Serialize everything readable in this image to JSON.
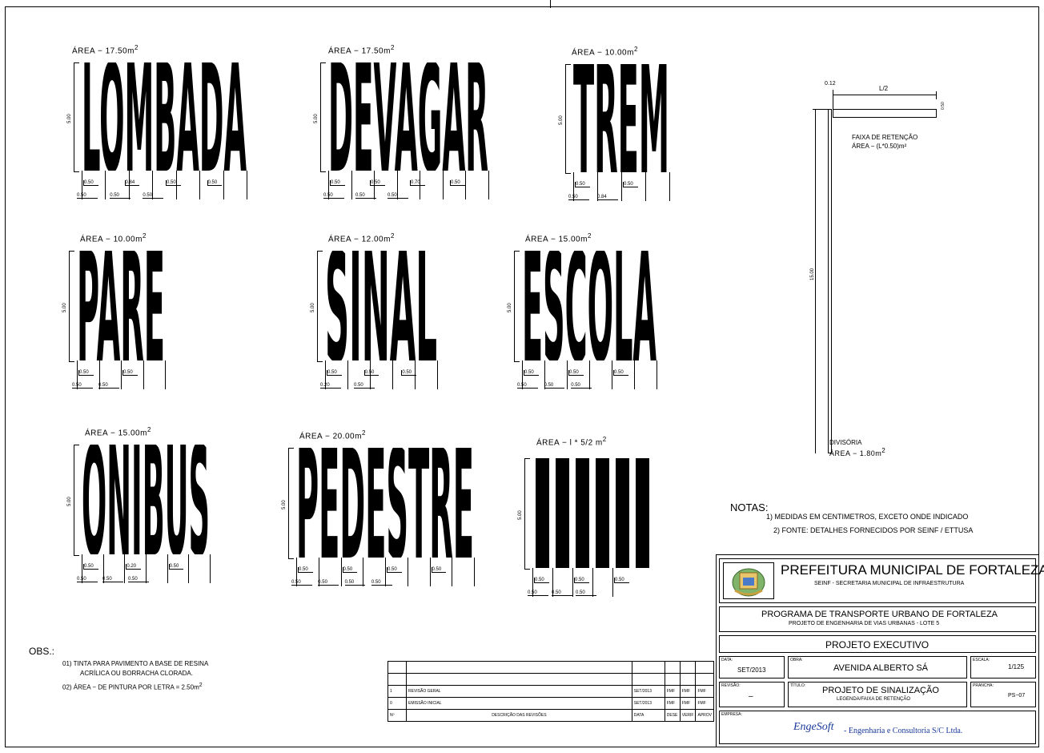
{
  "words": [
    {
      "text": "LOMBADA",
      "area": "ÁREA − 17.50m",
      "height": "5.00",
      "dims_top": [
        "0.50",
        "0.84",
        "0.50",
        "0.50"
      ],
      "dims_bottom": [
        "0.50",
        "0.50",
        "0.50"
      ]
    },
    {
      "text": "DEVAGAR",
      "area": "ÁREA − 17.50m",
      "height": "5.00",
      "dims_top": [
        "0.50",
        "0.50",
        "0.70",
        "0.50"
      ],
      "dims_bottom": [
        "0.50",
        "0.50",
        "0.50"
      ]
    },
    {
      "text": "TREM",
      "area": "ÁREA − 10.00m",
      "height": "5.00",
      "dims_top": [
        "0.50",
        "0.50"
      ],
      "dims_bottom": [
        "0.50",
        "0.84"
      ]
    },
    {
      "text": "PARE",
      "area": "ÁREA − 10.00m",
      "height": "5.00",
      "dims_top": [
        "0.50",
        "0.50"
      ],
      "dims_bottom": [
        "0.50",
        "0.50"
      ]
    },
    {
      "text": "SINAL",
      "area": "ÁREA − 12.00m",
      "height": "5.00",
      "dims_top": [
        "0.50",
        "0.50",
        "0.50"
      ],
      "dims_bottom": [
        "0.20",
        "0.50"
      ]
    },
    {
      "text": "ESCOLA",
      "area": "ÁREA − 15.00m",
      "height": "5.00",
      "dims_top": [
        "0.50",
        "0.50",
        "0.50"
      ],
      "dims_bottom": [
        "0.50",
        "0.50",
        "0.50"
      ]
    },
    {
      "text": "ÔNIBUS",
      "area": "ÁREA − 15.00m",
      "height": "5.00",
      "dims_top": [
        "0.50",
        "0.20",
        "0.50"
      ],
      "dims_bottom": [
        "0.50",
        "0.50",
        "0.50"
      ]
    },
    {
      "text": "PEDESTRE",
      "area": "ÁREA − 20.00m",
      "height": "5.00",
      "dims_top": [
        "0.50",
        "0.50",
        "0.50",
        "0.50"
      ],
      "dims_bottom": [
        "0.50",
        "0.50",
        "0.50",
        "0.50"
      ]
    },
    {
      "text": "",
      "area": "ÁREA − l * 5/2  m",
      "height": "5.00",
      "dims_top": [
        "0.50",
        "0.50",
        "0.50"
      ],
      "dims_bottom": [
        "0.50",
        "0.50",
        "0.50"
      ]
    }
  ],
  "sup2": "2",
  "retention": {
    "top_label": "0.12",
    "half": "L/2",
    "side": "0.50",
    "label1": "FAIXA DE RETENÇÃO",
    "label2": "ÁREA − (L*0.50)m²",
    "height": "15.00",
    "div1": "DIVISÓRIA",
    "div2": "ÁREA − 1.80m"
  },
  "notes": {
    "title": "NOTAS:",
    "items": [
      "1) MEDIDAS EM CENTIMETROS, EXCETO ONDE INDICADO",
      "2) FONTE: DETALHES FORNECIDOS POR SEINF / ETTUSA"
    ]
  },
  "obs": {
    "title": "OBS.:",
    "l1": "01) TINTA PARA PAVIMENTO A BASE DE RESINA",
    "l2": "ACRÍLICA OU BORRACHA CLORADA.",
    "l3": "02) ÁREA − DE PINTURA POR LETRA = 2.50m"
  },
  "revisions": {
    "rows": [
      {
        "n": "1",
        "desc": "REVISÃO GERAL",
        "data": "SET/2013",
        "a": "FMF",
        "b": "FMF",
        "c": "FMF"
      },
      {
        "n": "0",
        "desc": "EMISSÃO INICIAL",
        "data": "SET/2013",
        "a": "FMF",
        "b": "FMF",
        "c": "FMF"
      }
    ],
    "header": {
      "n": "Nº",
      "desc": "DESCRIÇÃO DAS REVISÕES",
      "data": "DATA",
      "a": "DESE",
      "b": "VERIF",
      "c": "APROV"
    }
  },
  "titleblock": {
    "org": "PREFEITURA MUNICIPAL DE FORTALEZA",
    "org_sub": "SEINF - SECRETARIA MUNICIPAL DE INFRAESTRUTURA",
    "prog": "PROGRAMA DE TRANSPORTE URBANO DE FORTALEZA",
    "prog_sub": "PROJETO DE ENGENHARIA DE VIAS URBANAS - LOTE 5",
    "phase": "PROJETO EXECUTIVO",
    "data_lbl": "DATA:",
    "data_val": "SET/2013",
    "obra_lbl": "OBRA:",
    "obra_val": "AVENIDA ALBERTO SÁ",
    "escala_lbl": "ESCALA:",
    "escala_val": "1/125",
    "rev_lbl": "REVISÃO:",
    "rev_val": "–",
    "titulo_lbl": "TÍTULO:",
    "titulo_val": "PROJETO DE SINALIZAÇÃO",
    "titulo_sub": "LEGENDA/FAIXA DE RETENÇÃO",
    "prancha_lbl": "PRANCHA:",
    "prancha_val": "PS−07",
    "empresa_lbl": "EMPRESA:",
    "empresa_logo": "EngeSoft",
    "empresa_val": "- Engenharia e Consultoria S/C Ltda."
  }
}
